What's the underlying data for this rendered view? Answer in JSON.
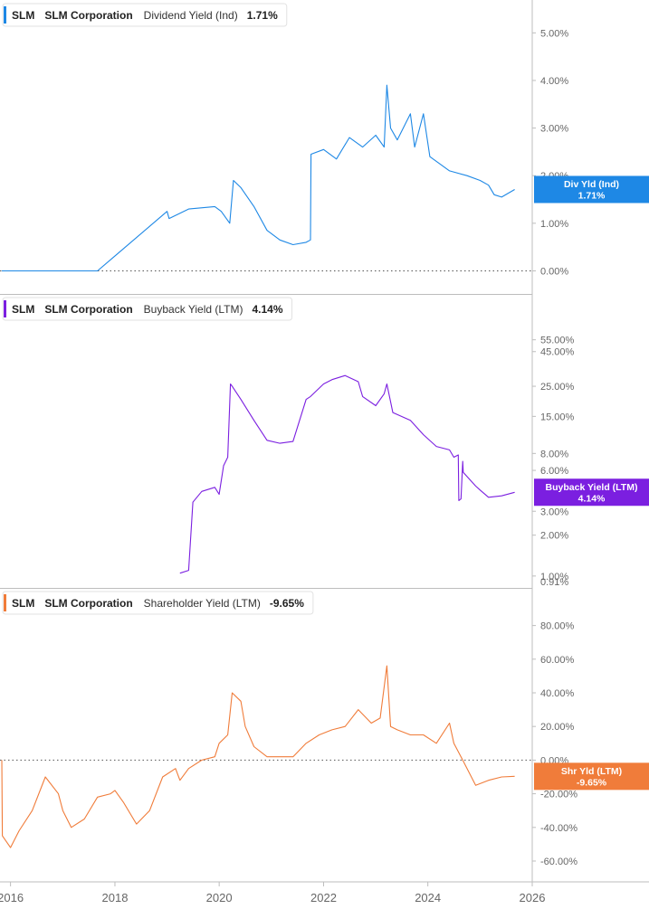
{
  "chart_data": [
    {
      "type": "line",
      "ticker": "SLM",
      "company": "SLM Corporation",
      "metric": "Dividend Yield (Ind)",
      "current_value": "1.71%",
      "badge_line1": "Div Yld (Ind)",
      "badge_line2": "1.71%",
      "color": "#1e88e5",
      "y_scale": "linear",
      "ylim": [
        -0.2,
        5.5
      ],
      "yticks": [
        {
          "value": 0,
          "label": "0.00%"
        },
        {
          "value": 1,
          "label": "1.00%"
        },
        {
          "value": 2,
          "label": "2.00%"
        },
        {
          "value": 3,
          "label": "3.00%"
        },
        {
          "value": 4,
          "label": "4.00%"
        },
        {
          "value": 5,
          "label": "5.00%"
        }
      ],
      "zero_line": true,
      "series": [
        {
          "x": [
            "2015-11-01",
            "2017-09-01",
            "2019-01-01",
            "2019-01-15",
            "2019-06-01",
            "2019-12-01",
            "2020-01-15",
            "2020-03-15",
            "2020-04-10",
            "2020-06-01",
            "2020-09-01",
            "2020-12-01",
            "2021-03-01",
            "2021-06-01",
            "2021-09-01",
            "2021-10-01",
            "2021-10-05",
            "2022-01-01",
            "2022-04-01",
            "2022-07-01",
            "2022-10-01",
            "2023-01-01",
            "2023-03-01",
            "2023-03-20",
            "2023-04-15",
            "2023-06-01",
            "2023-09-01",
            "2023-10-01",
            "2023-12-01",
            "2024-01-15",
            "2024-06-01",
            "2024-10-01",
            "2025-01-01",
            "2025-03-01",
            "2025-04-10",
            "2025-06-01",
            "2025-08-31"
          ],
          "y": [
            0.0,
            0.0,
            1.25,
            1.1,
            1.3,
            1.35,
            1.25,
            1.0,
            1.9,
            1.75,
            1.35,
            0.85,
            0.65,
            0.55,
            0.6,
            0.65,
            2.45,
            2.55,
            2.35,
            2.8,
            2.6,
            2.85,
            2.6,
            3.9,
            3.0,
            2.75,
            3.3,
            2.6,
            3.3,
            2.4,
            2.1,
            2.0,
            1.9,
            1.8,
            1.6,
            1.55,
            1.71
          ]
        }
      ]
    },
    {
      "type": "line",
      "ticker": "SLM",
      "company": "SLM Corporation",
      "metric": "Buyback Yield (LTM)",
      "current_value": "4.14%",
      "badge_line1": "Buyback Yield (LTM)",
      "badge_line2": "4.14%",
      "color": "#7b1fe0",
      "y_scale": "log",
      "ylim": [
        0.91,
        60
      ],
      "yticks": [
        {
          "value": 1,
          "label": "1.00%"
        },
        {
          "value": 2,
          "label": "2.00%"
        },
        {
          "value": 3,
          "label": "3.00%"
        },
        {
          "value": 6,
          "label": "6.00%"
        },
        {
          "value": 8,
          "label": "8.00%"
        },
        {
          "value": 15,
          "label": "15.00%"
        },
        {
          "value": 25,
          "label": "25.00%"
        },
        {
          "value": 45,
          "label": "45.00%"
        },
        {
          "value": 55,
          "label": "55.00%"
        }
      ],
      "ytick_edge_label": "0.91%",
      "series": [
        {
          "x": [
            "2019-04-01",
            "2019-06-01",
            "2019-07-01",
            "2019-09-01",
            "2019-12-01",
            "2020-01-01",
            "2020-02-01",
            "2020-03-01",
            "2020-03-20",
            "2020-04-01",
            "2020-06-01",
            "2020-09-01",
            "2020-12-01",
            "2021-03-01",
            "2021-06-01",
            "2021-09-01",
            "2021-10-01",
            "2022-01-01",
            "2022-03-01",
            "2022-06-01",
            "2022-09-01",
            "2022-10-01",
            "2023-01-01",
            "2023-03-01",
            "2023-03-20",
            "2023-05-01",
            "2023-09-01",
            "2023-12-01",
            "2024-03-01",
            "2024-06-01",
            "2024-07-01",
            "2024-08-01",
            "2024-08-05",
            "2024-08-20",
            "2024-09-01",
            "2024-09-05",
            "2024-12-01",
            "2025-01-01",
            "2025-03-01",
            "2025-06-01",
            "2025-08-31"
          ],
          "y": [
            1.05,
            1.1,
            3.5,
            4.2,
            4.5,
            4.0,
            6.5,
            7.5,
            26,
            25,
            20,
            14,
            10,
            9.5,
            9.8,
            20,
            21,
            26,
            28,
            30,
            27,
            21,
            18,
            22,
            26,
            16,
            14,
            11,
            9,
            8.5,
            7.5,
            7.8,
            3.6,
            3.7,
            7.0,
            5.8,
            4.6,
            4.3,
            3.8,
            3.9,
            4.14
          ]
        }
      ]
    },
    {
      "type": "line",
      "ticker": "SLM",
      "company": "SLM Corporation",
      "metric": "Shareholder Yield (LTM)",
      "current_value": "-9.65%",
      "badge_line1": "Shr Yld (LTM)",
      "badge_line2": "-9.65%",
      "color": "#f07c3a",
      "y_scale": "linear",
      "ylim": [
        -67,
        90
      ],
      "yticks": [
        {
          "value": -60,
          "label": "-60.00%"
        },
        {
          "value": -40,
          "label": "-40.00%"
        },
        {
          "value": -20,
          "label": "-20.00%"
        },
        {
          "value": 0,
          "label": "0.00%"
        },
        {
          "value": 20,
          "label": "20.00%"
        },
        {
          "value": 40,
          "label": "40.00%"
        },
        {
          "value": 60,
          "label": "60.00%"
        },
        {
          "value": 80,
          "label": "80.00%"
        }
      ],
      "zero_line": true,
      "series": [
        {
          "x": [
            "2015-11-01",
            "2015-11-05",
            "2016-01-01",
            "2016-03-01",
            "2016-06-01",
            "2016-09-01",
            "2016-12-01",
            "2017-01-01",
            "2017-03-01",
            "2017-06-01",
            "2017-09-01",
            "2017-12-01",
            "2018-01-01",
            "2018-03-01",
            "2018-06-01",
            "2018-09-01",
            "2018-12-01",
            "2019-03-01",
            "2019-04-01",
            "2019-06-01",
            "2019-09-01",
            "2019-12-01",
            "2020-01-01",
            "2020-03-01",
            "2020-04-01",
            "2020-06-01",
            "2020-07-01",
            "2020-09-01",
            "2020-12-01",
            "2021-03-01",
            "2021-06-01",
            "2021-09-01",
            "2021-12-01",
            "2022-03-01",
            "2022-06-01",
            "2022-09-01",
            "2022-12-01",
            "2023-02-01",
            "2023-03-20",
            "2023-04-15",
            "2023-06-01",
            "2023-09-01",
            "2023-12-01",
            "2024-03-01",
            "2024-06-01",
            "2024-07-01",
            "2024-09-01",
            "2024-12-01",
            "2025-03-01",
            "2025-06-01",
            "2025-08-31"
          ],
          "y": [
            0,
            -45,
            -52,
            -42,
            -30,
            -10,
            -20,
            -30,
            -40,
            -35,
            -22,
            -20,
            -18,
            -25,
            -38,
            -30,
            -10,
            -5,
            -12,
            -5,
            0,
            2,
            10,
            15,
            40,
            35,
            20,
            8,
            2,
            2,
            2,
            10,
            15,
            18,
            20,
            30,
            22,
            25,
            56,
            20,
            18,
            15,
            15,
            10,
            22,
            10,
            0,
            -15,
            -12,
            -10,
            -9.65
          ]
        }
      ]
    }
  ],
  "x_axis": {
    "range": [
      "2015-11-01",
      "2026-01-01"
    ],
    "ticks": [
      {
        "value": "2016-01-01",
        "label": "2016"
      },
      {
        "value": "2018-01-01",
        "label": "2018"
      },
      {
        "value": "2020-01-01",
        "label": "2020"
      },
      {
        "value": "2022-01-01",
        "label": "2022"
      },
      {
        "value": "2024-01-01",
        "label": "2024"
      },
      {
        "value": "2026-01-01",
        "label": "2026"
      }
    ]
  }
}
